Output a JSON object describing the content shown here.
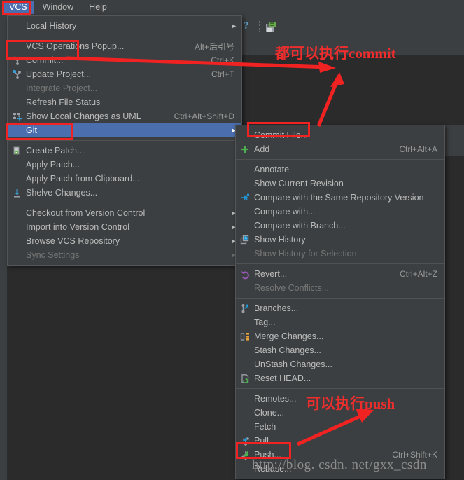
{
  "colors": {
    "menu_bg": "#3c3f41",
    "editor_bg": "#2b2b2b",
    "highlight": "#4b6eaf",
    "text": "#bbbbbb",
    "disabled_text": "#777777",
    "annotation_red": "#ef2d2d",
    "accent_green": "#5ba544",
    "accent_blue": "#3b9dd4"
  },
  "menubar": {
    "items": [
      {
        "label": "VCS",
        "mnemonic": "S",
        "selected": true
      },
      {
        "label": "Window",
        "mnemonic": "W",
        "selected": false
      },
      {
        "label": "Help",
        "mnemonic": "H",
        "selected": false
      }
    ]
  },
  "toolbar": {
    "help_icon": "question-mark-icon",
    "save_icon": "save-all-icon"
  },
  "vcs_menu": {
    "title": "VCS",
    "items": [
      {
        "label": "Local History",
        "accel": "",
        "icon": "",
        "submenu": true,
        "disabled": false
      },
      {
        "label": "VCS Operations Popup...",
        "accel": "Alt+后引号",
        "icon": "",
        "submenu": false,
        "disabled": false
      },
      {
        "label": "Commit...",
        "accel": "Ctrl+K",
        "icon": "commit-icon",
        "submenu": false,
        "disabled": false
      },
      {
        "label": "Update Project...",
        "accel": "Ctrl+T",
        "icon": "update-icon",
        "submenu": false,
        "disabled": false
      },
      {
        "label": "Integrate Project...",
        "accel": "",
        "icon": "",
        "submenu": false,
        "disabled": true
      },
      {
        "label": "Refresh File Status",
        "accel": "",
        "icon": "",
        "submenu": false,
        "disabled": false
      },
      {
        "label": "Show Local Changes as UML",
        "accel": "Ctrl+Alt+Shift+D",
        "icon": "uml-icon",
        "submenu": false,
        "disabled": false
      },
      {
        "label": "Git",
        "accel": "",
        "icon": "",
        "submenu": true,
        "disabled": false,
        "selected": true
      },
      {
        "separator_after": false,
        "label": "Create Patch...",
        "accel": "",
        "icon": "patch-icon",
        "submenu": false,
        "disabled": false
      },
      {
        "label": "Apply Patch...",
        "accel": "",
        "icon": "",
        "submenu": false,
        "disabled": false
      },
      {
        "label": "Apply Patch from Clipboard...",
        "accel": "",
        "icon": "",
        "submenu": false,
        "disabled": false
      },
      {
        "label": "Shelve Changes...",
        "accel": "",
        "icon": "shelve-icon",
        "submenu": false,
        "disabled": false
      },
      {
        "label": "Checkout from Version Control",
        "accel": "",
        "icon": "",
        "submenu": true,
        "disabled": false
      },
      {
        "label": "Import into Version Control",
        "accel": "",
        "icon": "",
        "submenu": true,
        "disabled": false
      },
      {
        "label": "Browse VCS Repository",
        "accel": "",
        "icon": "",
        "submenu": true,
        "disabled": false
      },
      {
        "label": "Sync Settings",
        "accel": "",
        "icon": "",
        "submenu": true,
        "disabled": true
      }
    ]
  },
  "git_menu": {
    "title": "Git",
    "items": [
      {
        "label": "Commit File...",
        "accel": "",
        "icon": "",
        "disabled": false
      },
      {
        "label": "Add",
        "accel": "Ctrl+Alt+A",
        "icon": "add-plus-icon",
        "disabled": false
      },
      {
        "label": "Annotate",
        "accel": "",
        "icon": "",
        "disabled": false
      },
      {
        "label": "Show Current Revision",
        "accel": "",
        "icon": "",
        "disabled": false
      },
      {
        "label": "Compare with the Same Repository Version",
        "accel": "",
        "icon": "compare-icon",
        "disabled": false
      },
      {
        "label": "Compare with...",
        "accel": "",
        "icon": "",
        "disabled": false
      },
      {
        "label": "Compare with Branch...",
        "accel": "",
        "icon": "",
        "disabled": false
      },
      {
        "label": "Show History",
        "accel": "",
        "icon": "history-icon",
        "disabled": false
      },
      {
        "label": "Show History for Selection",
        "accel": "",
        "icon": "",
        "disabled": true
      },
      {
        "label": "Revert...",
        "accel": "Ctrl+Alt+Z",
        "icon": "revert-icon",
        "disabled": false
      },
      {
        "label": "Resolve Conflicts...",
        "accel": "",
        "icon": "",
        "disabled": true
      },
      {
        "label": "Branches...",
        "accel": "",
        "icon": "branch-icon",
        "disabled": false
      },
      {
        "label": "Tag...",
        "accel": "",
        "icon": "",
        "disabled": false
      },
      {
        "label": "Merge Changes...",
        "accel": "",
        "icon": "merge-icon",
        "disabled": false
      },
      {
        "label": "Stash Changes...",
        "accel": "",
        "icon": "",
        "disabled": false
      },
      {
        "label": "UnStash Changes...",
        "accel": "",
        "icon": "",
        "disabled": false
      },
      {
        "label": "Reset HEAD...",
        "accel": "",
        "icon": "reset-icon",
        "disabled": false
      },
      {
        "label": "Remotes...",
        "accel": "",
        "icon": "",
        "disabled": false
      },
      {
        "label": "Clone...",
        "accel": "",
        "icon": "",
        "disabled": false
      },
      {
        "label": "Fetch",
        "accel": "",
        "icon": "",
        "disabled": false
      },
      {
        "label": "Pull...",
        "accel": "",
        "icon": "pull-icon",
        "disabled": false
      },
      {
        "label": "Push...",
        "accel": "Ctrl+Shift+K",
        "icon": "push-icon",
        "disabled": false
      },
      {
        "label": "Rebase...",
        "accel": "",
        "icon": "",
        "disabled": false
      }
    ]
  },
  "annotations": {
    "commit_note": "都可以执行commit",
    "push_note": "可以执行push"
  },
  "watermark": {
    "text": "http://blog. csdn. net/gxx_csdn"
  }
}
